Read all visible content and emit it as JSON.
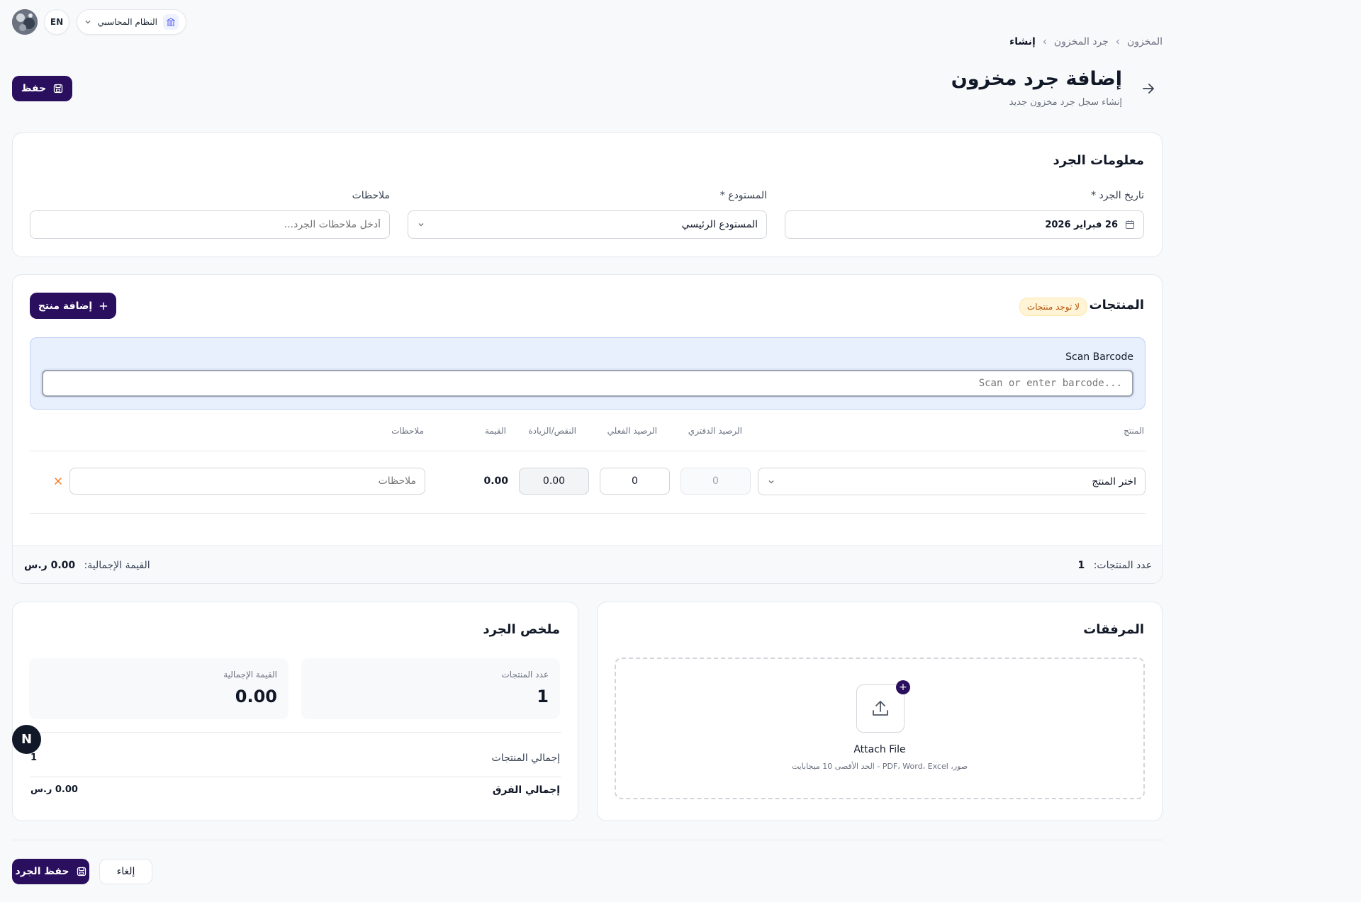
{
  "header": {
    "lang_label": "EN",
    "system_label": "النظام المحاسبي",
    "breadcrumb": [
      "المخزون",
      "جرد المخزون",
      "إنشاء"
    ],
    "title": "إضافة جرد مخزون",
    "subtitle": "إنشاء سجل جرد مخزون جديد",
    "save_label": "حفظ"
  },
  "info": {
    "title": "معلومات الجرد",
    "date_label": "تاريخ الجرد *",
    "date_value": "26 فبراير 2026",
    "warehouse_label": "المستودع *",
    "warehouse_value": "المستودع الرئيسي",
    "notes_label": "ملاحظات",
    "notes_placeholder": "أدخل ملاحظات الجرد..."
  },
  "products": {
    "title": "المنتجات",
    "badge": "لا توجد منتجات",
    "add_label": "إضافة منتج",
    "barcode_label": "Scan Barcode",
    "barcode_placeholder": "Scan or enter barcode...",
    "columns": {
      "product": "المنتج",
      "book": "الرصيد الدفتري",
      "actual": "الرصيد الفعلي",
      "diff": "النقص/الزيادة",
      "value": "القيمة",
      "notes": "ملاحظات"
    },
    "row": {
      "product_placeholder": "اختر المنتج",
      "book": "0",
      "actual": "0",
      "diff": "0.00",
      "value": "0.00",
      "notes_placeholder": "ملاحظات"
    },
    "footer": {
      "count_label": "عدد المنتجات:",
      "count_value": "1",
      "total_label": "القيمة الإجمالية:",
      "total_value": "0.00 ر.س"
    }
  },
  "summary": {
    "title": "ملخص الجرد",
    "count_label": "عدد المنتجات",
    "count_value": "1",
    "total_label": "القيمة الإجمالية",
    "total_value": "0.00",
    "products_total_label": "إجمالي المنتجات",
    "products_total_value": "1",
    "diff_total_label": "إجمالي الفرق",
    "diff_total_value": "0.00 ر.س"
  },
  "attachments": {
    "title": "المرفقات",
    "attach_label": "Attach File",
    "attach_hint": "صور، PDF، Word، Excel - الحد الأقصى 10 ميجابايت"
  },
  "actions": {
    "cancel_label": "إلغاء",
    "save_label": "حفظ الجرد"
  },
  "fab_label": "N",
  "colors": {
    "primary": "#2a0f5e",
    "background": "#f8f9fb",
    "badge_bg": "#fff4d6",
    "badge_text": "#b45309",
    "barcode_bg": "#e8effd",
    "remove_icon": "#f97316"
  }
}
